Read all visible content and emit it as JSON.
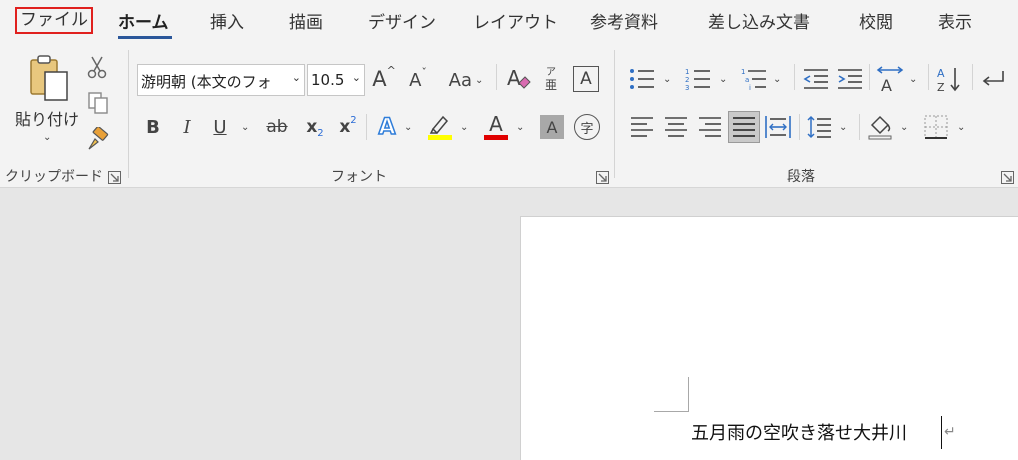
{
  "tabs": {
    "file": "ファイル",
    "home": "ホーム",
    "insert": "挿入",
    "draw": "描画",
    "design": "デザイン",
    "layout": "レイアウト",
    "references": "参考資料",
    "mailings": "差し込み文書",
    "review": "校閲",
    "view": "表示"
  },
  "clipboard": {
    "paste_label": "貼り付け",
    "group_label": "クリップボード"
  },
  "font": {
    "font_name": "游明朝 (本文のフォ",
    "font_size": "10.5",
    "group_label": "フォント",
    "grow": "A",
    "shrink": "A",
    "change_case": "Aa",
    "bold": "B",
    "italic": "I",
    "underline": "U",
    "strikethrough": "ab",
    "subscript": "x",
    "superscript": "x",
    "text_effects": "A",
    "font_color": "A",
    "char_shading": "A",
    "enclose": "字",
    "char_border": "A",
    "phonetic_top": "ア",
    "phonetic_bottom": "亜"
  },
  "paragraph": {
    "group_label": "段落"
  },
  "document": {
    "text": "五月雨の空吹き落せ大井川"
  },
  "colors": {
    "tab_accent": "#2b579a",
    "file_highlight_border": "#e0201e",
    "highlight_yellow": "#ffff00",
    "font_red": "#e00000",
    "ribbon_bg": "#f3f3f3",
    "canvas_bg": "#e6e6e6"
  },
  "icons": {
    "cut": "scissors-icon",
    "copy": "copy-icon",
    "format_painter": "paintbrush-icon",
    "clear_format": "eraser-icon"
  }
}
